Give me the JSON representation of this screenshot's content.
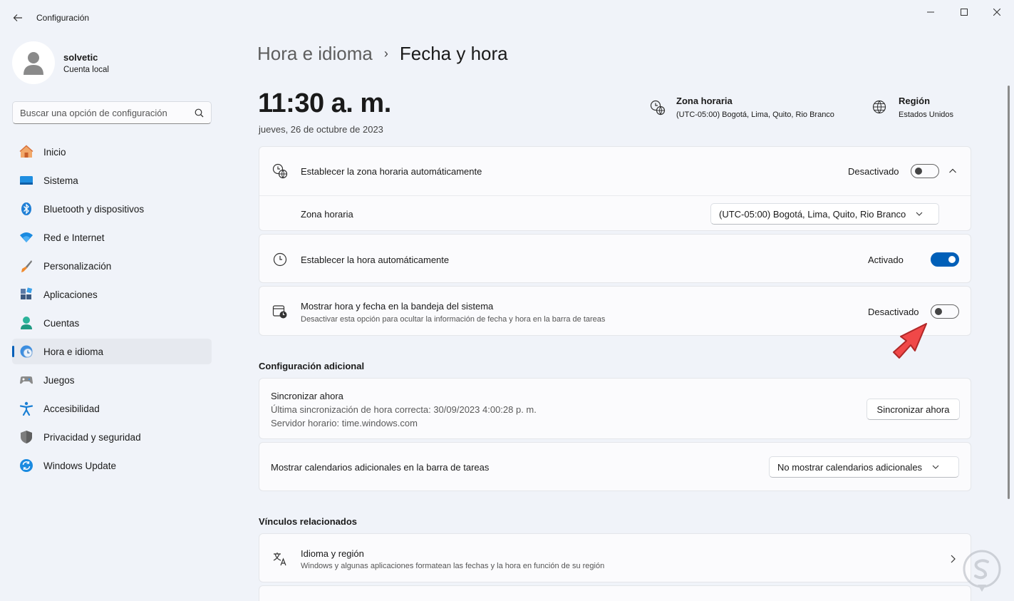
{
  "window": {
    "title": "Configuración"
  },
  "profile": {
    "name": "solvetic",
    "account_type": "Cuenta local"
  },
  "search": {
    "placeholder": "Buscar una opción de configuración"
  },
  "sidebar": {
    "items": [
      {
        "label": "Inicio",
        "icon": "home-icon"
      },
      {
        "label": "Sistema",
        "icon": "system-icon"
      },
      {
        "label": "Bluetooth y dispositivos",
        "icon": "bluetooth-icon"
      },
      {
        "label": "Red e Internet",
        "icon": "wifi-icon"
      },
      {
        "label": "Personalización",
        "icon": "brush-icon"
      },
      {
        "label": "Aplicaciones",
        "icon": "apps-icon"
      },
      {
        "label": "Cuentas",
        "icon": "accounts-icon"
      },
      {
        "label": "Hora e idioma",
        "icon": "time-language-icon",
        "active": true
      },
      {
        "label": "Juegos",
        "icon": "gamepad-icon"
      },
      {
        "label": "Accesibilidad",
        "icon": "accessibility-icon"
      },
      {
        "label": "Privacidad y seguridad",
        "icon": "shield-icon"
      },
      {
        "label": "Windows Update",
        "icon": "update-icon"
      }
    ]
  },
  "breadcrumb": {
    "parent": "Hora e idioma",
    "separator": "›",
    "current": "Fecha y hora"
  },
  "clock": {
    "time": "11:30 a. m.",
    "date": "jueves, 26 de octubre de 2023"
  },
  "timezone_info": {
    "label": "Zona horaria",
    "value": "(UTC-05:00) Bogotá, Lima, Quito, Rio Branco"
  },
  "region_info": {
    "label": "Región",
    "value": "Estados Unidos"
  },
  "settings": {
    "auto_timezone": {
      "title": "Establecer la zona horaria automáticamente",
      "state": "Desactivado",
      "on": false
    },
    "timezone": {
      "title": "Zona horaria",
      "selected": "(UTC-05:00) Bogotá, Lima, Quito, Rio Branco"
    },
    "auto_time": {
      "title": "Establecer la hora automáticamente",
      "state": "Activado",
      "on": true
    },
    "tray": {
      "title": "Mostrar hora y fecha en la bandeja del sistema",
      "subtitle": "Desactivar esta opción para ocultar la información de fecha y hora en la barra de tareas",
      "state": "Desactivado",
      "on": false
    }
  },
  "additional": {
    "heading": "Configuración adicional",
    "sync": {
      "title": "Sincronizar ahora",
      "last_sync": "Última sincronización de hora correcta: 30/09/2023 4:00:28 p. m.",
      "server": "Servidor horario: time.windows.com",
      "button": "Sincronizar ahora"
    },
    "calendars": {
      "title": "Mostrar calendarios adicionales en la barra de tareas",
      "selected": "No mostrar calendarios adicionales"
    }
  },
  "related": {
    "heading": "Vínculos relacionados",
    "language_region": {
      "title": "Idioma y región",
      "subtitle": "Windows y algunas aplicaciones formatean las fechas y la hora en función de su región"
    }
  },
  "colors": {
    "accent": "#005fb8",
    "background": "#f0f3f9",
    "card": "#fbfbfd",
    "arrow": "#f04848"
  }
}
